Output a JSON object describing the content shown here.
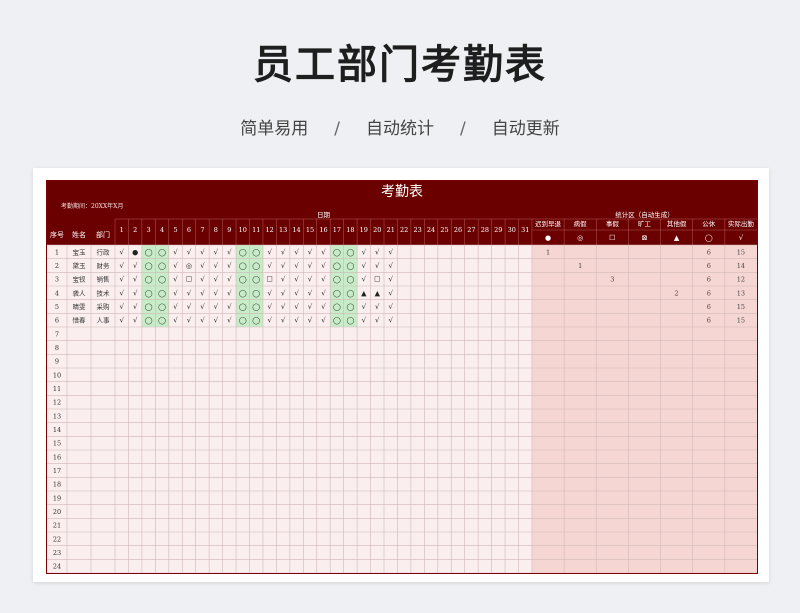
{
  "page_title": "员工部门考勤表",
  "subtitle_items": [
    "简单易用",
    "自动统计",
    "自动更新"
  ],
  "subtitle_separator": "/",
  "sheet": {
    "title": "考勤表",
    "period_label": "考勤期间：20XX年X月",
    "header_seq": "序号",
    "header_name": "姓名",
    "header_dept": "部门",
    "header_date_group": "日期",
    "header_stats_group": "统计区（自动生成）",
    "days": [
      "1",
      "2",
      "3",
      "4",
      "5",
      "6",
      "7",
      "8",
      "9",
      "10",
      "11",
      "12",
      "13",
      "14",
      "15",
      "16",
      "17",
      "18",
      "19",
      "20",
      "21",
      "22",
      "23",
      "24",
      "25",
      "26",
      "27",
      "28",
      "29",
      "30",
      "31"
    ],
    "stat_columns": [
      {
        "label": "迟到早退",
        "symbol": "●"
      },
      {
        "label": "病假",
        "symbol": "◎"
      },
      {
        "label": "事假",
        "symbol": "☐"
      },
      {
        "label": "旷工",
        "symbol": "⊠"
      },
      {
        "label": "其他假",
        "symbol": "▲"
      },
      {
        "label": "公休",
        "symbol": "◯"
      },
      {
        "label": "实际出勤",
        "symbol": "√"
      }
    ],
    "rows": [
      {
        "seq": "1",
        "name": "宝玉",
        "dept": "行政",
        "days": [
          "√",
          "●",
          "◯",
          "◯",
          "√",
          "√",
          "√",
          "√",
          "√",
          "◯",
          "◯",
          "√",
          "√",
          "√",
          "√",
          "√",
          "◯",
          "◯",
          "√",
          "√",
          "√",
          "",
          "",
          "",
          "",
          "",
          "",
          "",
          "",
          "",
          ""
        ],
        "stats": [
          "1",
          "",
          "",
          "",
          "",
          "6",
          "15"
        ]
      },
      {
        "seq": "2",
        "name": "黛玉",
        "dept": "财务",
        "days": [
          "√",
          "√",
          "◯",
          "◯",
          "√",
          "◎",
          "√",
          "√",
          "√",
          "◯",
          "◯",
          "√",
          "√",
          "√",
          "√",
          "√",
          "◯",
          "◯",
          "√",
          "√",
          "√",
          "",
          "",
          "",
          "",
          "",
          "",
          "",
          "",
          "",
          ""
        ],
        "stats": [
          "",
          "1",
          "",
          "",
          "",
          "6",
          "14"
        ]
      },
      {
        "seq": "3",
        "name": "宝钗",
        "dept": "销售",
        "days": [
          "√",
          "√",
          "◯",
          "◯",
          "√",
          "☐",
          "√",
          "√",
          "√",
          "◯",
          "◯",
          "☐",
          "√",
          "√",
          "√",
          "√",
          "◯",
          "◯",
          "√",
          "☐",
          "√",
          "",
          "",
          "",
          "",
          "",
          "",
          "",
          "",
          "",
          ""
        ],
        "stats": [
          "",
          "",
          "3",
          "",
          "",
          "6",
          "12"
        ]
      },
      {
        "seq": "4",
        "name": "袭人",
        "dept": "技术",
        "days": [
          "√",
          "√",
          "◯",
          "◯",
          "√",
          "√",
          "√",
          "√",
          "√",
          "◯",
          "◯",
          "√",
          "√",
          "√",
          "√",
          "√",
          "◯",
          "◯",
          "▲",
          "▲",
          "√",
          "",
          "",
          "",
          "",
          "",
          "",
          "",
          "",
          "",
          ""
        ],
        "stats": [
          "",
          "",
          "",
          "",
          "2",
          "6",
          "13"
        ]
      },
      {
        "seq": "5",
        "name": "晴雯",
        "dept": "采购",
        "days": [
          "√",
          "√",
          "◯",
          "◯",
          "√",
          "√",
          "√",
          "√",
          "√",
          "◯",
          "◯",
          "√",
          "√",
          "√",
          "√",
          "√",
          "◯",
          "◯",
          "√",
          "√",
          "√",
          "",
          "",
          "",
          "",
          "",
          "",
          "",
          "",
          "",
          ""
        ],
        "stats": [
          "",
          "",
          "",
          "",
          "",
          "6",
          "15"
        ]
      },
      {
        "seq": "6",
        "name": "惜春",
        "dept": "人事",
        "days": [
          "√",
          "√",
          "◯",
          "◯",
          "√",
          "√",
          "√",
          "√",
          "√",
          "◯",
          "◯",
          "√",
          "√",
          "√",
          "√",
          "√",
          "◯",
          "◯",
          "√",
          "√",
          "√",
          "",
          "",
          "",
          "",
          "",
          "",
          "",
          "",
          "",
          ""
        ],
        "stats": [
          "",
          "",
          "",
          "",
          "",
          "6",
          "15"
        ]
      },
      {
        "seq": "7",
        "name": "",
        "dept": "",
        "days": [],
        "stats": []
      },
      {
        "seq": "8",
        "name": "",
        "dept": "",
        "days": [],
        "stats": []
      },
      {
        "seq": "9",
        "name": "",
        "dept": "",
        "days": [],
        "stats": []
      },
      {
        "seq": "10",
        "name": "",
        "dept": "",
        "days": [],
        "stats": []
      },
      {
        "seq": "11",
        "name": "",
        "dept": "",
        "days": [],
        "stats": []
      },
      {
        "seq": "12",
        "name": "",
        "dept": "",
        "days": [],
        "stats": []
      },
      {
        "seq": "13",
        "name": "",
        "dept": "",
        "days": [],
        "stats": []
      },
      {
        "seq": "14",
        "name": "",
        "dept": "",
        "days": [],
        "stats": []
      },
      {
        "seq": "15",
        "name": "",
        "dept": "",
        "days": [],
        "stats": []
      },
      {
        "seq": "16",
        "name": "",
        "dept": "",
        "days": [],
        "stats": []
      },
      {
        "seq": "17",
        "name": "",
        "dept": "",
        "days": [],
        "stats": []
      },
      {
        "seq": "18",
        "name": "",
        "dept": "",
        "days": [],
        "stats": []
      },
      {
        "seq": "19",
        "name": "",
        "dept": "",
        "days": [],
        "stats": []
      },
      {
        "seq": "20",
        "name": "",
        "dept": "",
        "days": [],
        "stats": []
      },
      {
        "seq": "21",
        "name": "",
        "dept": "",
        "days": [],
        "stats": []
      },
      {
        "seq": "22",
        "name": "",
        "dept": "",
        "days": [],
        "stats": []
      },
      {
        "seq": "23",
        "name": "",
        "dept": "",
        "days": [],
        "stats": []
      },
      {
        "seq": "24",
        "name": "",
        "dept": "",
        "days": [],
        "stats": []
      }
    ],
    "weekend_day_indices": [
      2,
      3,
      9,
      10,
      16,
      17
    ]
  },
  "colors": {
    "header_dark": "#6b0000",
    "header_mid": "#8a0b0b",
    "row_bg": "#fbeeee",
    "stats_bg": "#f6d6d3",
    "weekend_green": "#c8ecc8",
    "grid_line": "#cfb9b9"
  }
}
